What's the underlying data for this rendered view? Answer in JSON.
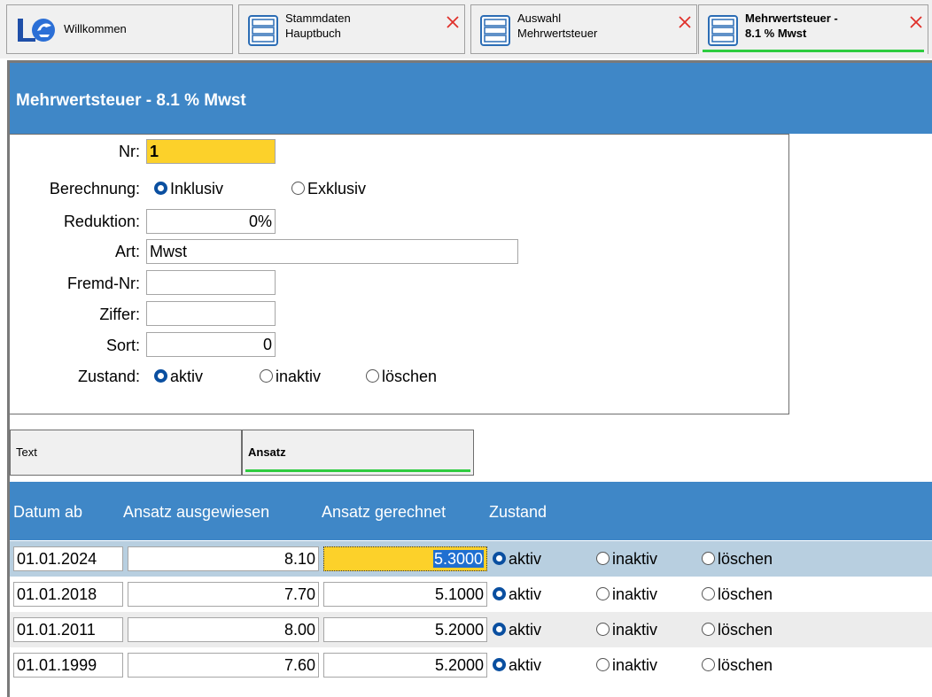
{
  "tabs": {
    "welcome": {
      "label": "Willkommen"
    },
    "stammdaten": {
      "label": "Stammdaten\nHauptbuch"
    },
    "auswahl": {
      "label": "Auswahl\nMehrwertsteuer"
    },
    "mwst": {
      "label": "Mehrwertsteuer -\n8.1 % Mwst"
    }
  },
  "header": {
    "title": "Mehrwertsteuer - 8.1 % Mwst"
  },
  "form": {
    "nr": {
      "label": "Nr:",
      "value": "1"
    },
    "berechnung": {
      "label": "Berechnung:",
      "options": [
        "Inklusiv",
        "Exklusiv"
      ],
      "selected": "Inklusiv"
    },
    "reduktion": {
      "label": "Reduktion:",
      "value": "0%"
    },
    "art": {
      "label": "Art:",
      "value": "Mwst"
    },
    "fremd_nr": {
      "label": "Fremd-Nr:",
      "value": ""
    },
    "ziffer": {
      "label": "Ziffer:",
      "value": ""
    },
    "sort": {
      "label": "Sort:",
      "value": "0"
    },
    "zustand": {
      "label": "Zustand:",
      "options": [
        "aktiv",
        "inaktiv",
        "löschen"
      ],
      "selected": "aktiv"
    }
  },
  "subtabs": [
    {
      "label": "Text",
      "active": false
    },
    {
      "label": "Ansatz",
      "active": true
    }
  ],
  "table": {
    "headers": [
      "Datum ab",
      "Ansatz ausgewiesen",
      "Ansatz gerechnet",
      "Zustand"
    ],
    "zustand_options": [
      "aktiv",
      "inaktiv",
      "löschen"
    ],
    "rows": [
      {
        "datum": "01.01.2024",
        "ausgewiesen": "8.10",
        "gerechnet": "5.3000",
        "zustand": "aktiv"
      },
      {
        "datum": "01.01.2018",
        "ausgewiesen": "7.70",
        "gerechnet": "5.1000",
        "zustand": "aktiv"
      },
      {
        "datum": "01.01.2011",
        "ausgewiesen": "8.00",
        "gerechnet": "5.2000",
        "zustand": "aktiv"
      },
      {
        "datum": "01.01.1999",
        "ausgewiesen": "7.60",
        "gerechnet": "5.2000",
        "zustand": "aktiv"
      }
    ]
  },
  "colors": {
    "header_blue": "#3f87c7",
    "highlight_yellow": "#fcd12a",
    "active_green": "#2ecc40",
    "radio_blue": "#0a4fa0",
    "selected_row": "#b8cfe0",
    "alt_row": "#ececec"
  }
}
